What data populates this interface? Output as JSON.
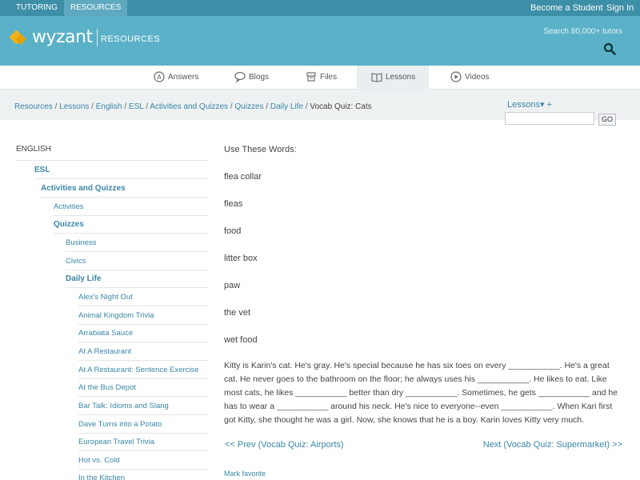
{
  "topbar": {
    "tabs": [
      "TUTORING",
      "RESOURCES"
    ],
    "links": [
      "Become a Student",
      "Sign In"
    ]
  },
  "header": {
    "logo_text": "wyzant",
    "section": "RESOURCES",
    "search_hint": "Search 80,000+ tutors"
  },
  "nav": [
    "Answers",
    "Blogs",
    "Files",
    "Lessons",
    "Videos"
  ],
  "breadcrumb": [
    "Resources",
    "Lessons",
    "English",
    "ESL",
    "Activities and Quizzes",
    "Quizzes",
    "Daily Life",
    "Vocab Quiz: Cats"
  ],
  "search": {
    "dropdown": "Lessons▾ +",
    "go": "GO"
  },
  "sidebar": {
    "heading": "ENGLISH",
    "items": [
      {
        "label": "ESL"
      },
      {
        "label": "Activities and Quizzes"
      },
      {
        "label": "Activities"
      },
      {
        "label": "Quizzes"
      },
      {
        "label": "Business"
      },
      {
        "label": "Civics"
      },
      {
        "label": "Daily Life"
      },
      {
        "label": "Alex's Night Out"
      },
      {
        "label": "Animal Kingdom Trivia"
      },
      {
        "label": "Arrabiata Sauce"
      },
      {
        "label": "At A Restaurant"
      },
      {
        "label": "At A Restaurant: Sentence Exercise"
      },
      {
        "label": "At the Bus Depot"
      },
      {
        "label": "Bar Talk: Idioms and Slang"
      },
      {
        "label": "Dave Turns into a Potato"
      },
      {
        "label": "European Travel Trivia"
      },
      {
        "label": "Hot vs. Cold"
      },
      {
        "label": "In the Kitchen"
      }
    ]
  },
  "main": {
    "intro": "Use These Words:",
    "words": [
      "flea collar",
      "fleas",
      "food",
      "litter box",
      "paw",
      "the vet",
      "wet food"
    ],
    "story": "Kitty is Karin's cat. He's gray. He's special because he has six toes on every ___________. He's a great cat. He never goes to the bathroom on the floor; he always uses his ___________. He likes to eat. Like most cats, he likes ___________ better than dry ___________. Sometimes, he gets ___________ and he has to wear a ___________ around his neck. He's nice to everyone--even ___________. When Kari first got Kitty, she thought he was a girl. Now, she knows that he is a boy. Karin loves Kitty very much.",
    "prev": "<< Prev (Vocab Quiz: Airports)",
    "next": "Next (Vocab Quiz: Supermarket) >>",
    "mark_favorite": "Mark favorite"
  }
}
